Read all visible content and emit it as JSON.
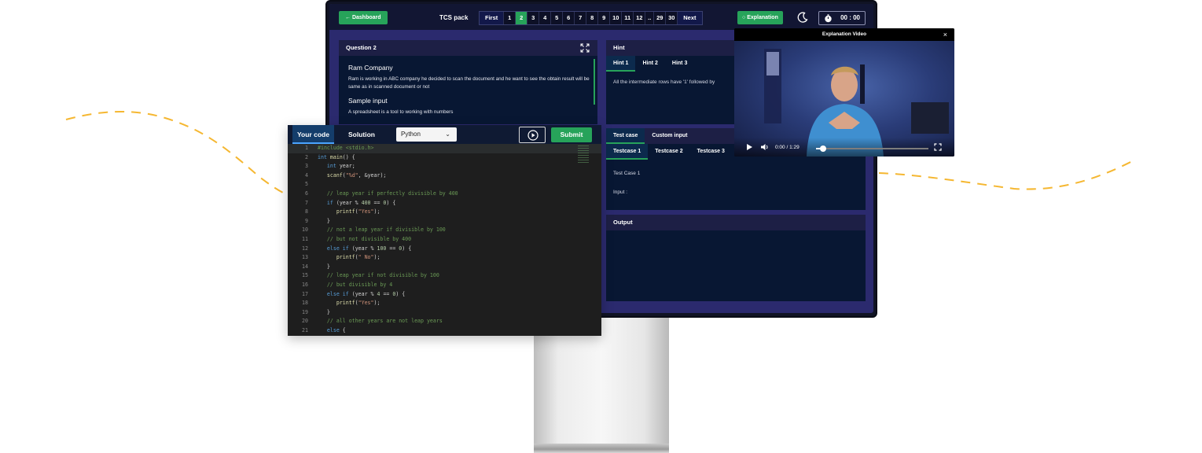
{
  "topbar": {
    "dashboard_label": "Dashboard",
    "pack_title": "TCS pack",
    "pager": {
      "first": "First",
      "pages": [
        "1",
        "2",
        "3",
        "4",
        "5",
        "6",
        "7",
        "8",
        "9",
        "10",
        "11",
        "12",
        "..",
        "29",
        "30"
      ],
      "active_page": "2",
      "next": "Next"
    },
    "explanation_label": "Explanation",
    "timer": "00 : 00"
  },
  "question": {
    "header": "Question 2",
    "title": "Ram Company",
    "body": "Ram is working in ABC company he decided to scan the document and he want to see the obtain result will be same as in scanned document or not",
    "sample_heading": "Sample input",
    "sample_text": "A spreadsheet is a tool to working with numbers"
  },
  "hint": {
    "header": "Hint",
    "tabs": [
      "Hint 1",
      "Hint 2",
      "Hint 3"
    ],
    "text": "All the intermediate rows have '1' followed by"
  },
  "testcase": {
    "tabs": [
      "Test case",
      "Custom input"
    ],
    "cases": [
      "Testcase 1",
      "Testcase 2",
      "Testcase 3"
    ],
    "case_label": "Test Case 1",
    "input_label": "Input :"
  },
  "output": {
    "header": "Output"
  },
  "editor": {
    "tab_code": "Your code",
    "tab_solution": "Solution",
    "language": "Python",
    "submit": "Submit",
    "lines": [
      {
        "n": "1",
        "t": "#include <stdio.h>"
      },
      {
        "n": "2",
        "t": "int main() {"
      },
      {
        "n": "3",
        "t": "   int year;"
      },
      {
        "n": "4",
        "t": "   scanf(\"%d\", &year);"
      },
      {
        "n": "5",
        "t": ""
      },
      {
        "n": "6",
        "t": "   // leap year if perfectly divisible by 400"
      },
      {
        "n": "7",
        "t": "   if (year % 400 == 0) {"
      },
      {
        "n": "8",
        "t": "      printf(\"Yes\");"
      },
      {
        "n": "9",
        "t": "   }"
      },
      {
        "n": "10",
        "t": "   // not a leap year if divisible by 100"
      },
      {
        "n": "11",
        "t": "   // but not divisible by 400"
      },
      {
        "n": "12",
        "t": "   else if (year % 100 == 0) {"
      },
      {
        "n": "13",
        "t": "      printf(\" No\");"
      },
      {
        "n": "14",
        "t": "   }"
      },
      {
        "n": "15",
        "t": "   // leap year if not divisible by 100"
      },
      {
        "n": "16",
        "t": "   // but divisible by 4"
      },
      {
        "n": "17",
        "t": "   else if (year % 4 == 0) {"
      },
      {
        "n": "18",
        "t": "      printf(\"Yes\");"
      },
      {
        "n": "19",
        "t": "   }"
      },
      {
        "n": "20",
        "t": "   // all other years are not leap years"
      },
      {
        "n": "21",
        "t": "   else {"
      }
    ]
  },
  "video": {
    "title": "Explanation Video",
    "time": "0:00 / 1:29",
    "progress": 0.06
  },
  "colors": {
    "accent_green": "#27a35a",
    "wave": "#f5b731",
    "screen_bg": "#2b2a6e"
  },
  "icons": [
    "arrow-left-icon",
    "bulb-icon",
    "moon-icon",
    "stopwatch-icon",
    "expand-icon",
    "play-circle-icon",
    "play-icon",
    "volume-icon",
    "fullscreen-icon",
    "close-icon",
    "chevron-down-icon"
  ]
}
